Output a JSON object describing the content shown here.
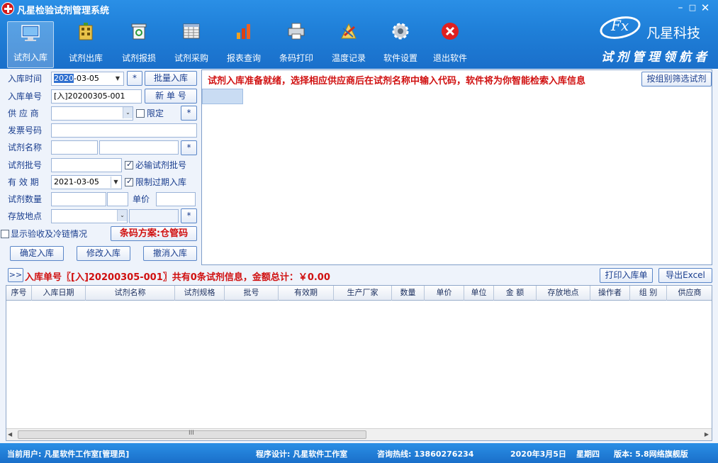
{
  "window": {
    "title": "凡星检验试剂管理系统",
    "min": "–",
    "max": "□",
    "close": "✕"
  },
  "brand": {
    "fx": "Fx",
    "name": "凡星科技",
    "slogan": "试剂管理领航者"
  },
  "toolbar": [
    {
      "label": "试剂入库",
      "icon": "monitor-icon"
    },
    {
      "label": "试剂出库",
      "icon": "building-icon"
    },
    {
      "label": "试剂报损",
      "icon": "recycle-bin-icon"
    },
    {
      "label": "试剂采购",
      "icon": "spreadsheet-icon"
    },
    {
      "label": "报表查询",
      "icon": "bar-chart-icon"
    },
    {
      "label": "条码打印",
      "icon": "printer-icon"
    },
    {
      "label": "温度记录",
      "icon": "thermometer-icon"
    },
    {
      "label": "软件设置",
      "icon": "gear-icon"
    },
    {
      "label": "退出软件",
      "icon": "exit-icon"
    }
  ],
  "form": {
    "date_label": "入库时间",
    "date_year": "2020",
    "date_rest": "-03-05",
    "star": "*",
    "batch_in": "批量入库",
    "order_label": "入库单号",
    "order_value": "[入]20200305-001",
    "new_order": "新 单 号",
    "supplier_label": "供 应 商",
    "supplier_value": "",
    "limit_label": "限定",
    "invoice_label": "发票号码",
    "invoice_value": "",
    "reagent_name_label": "试剂名称",
    "reagent_code": "",
    "reagent_name": "",
    "batch_label": "试剂批号",
    "batch_value": "",
    "must_batch": "必输试剂批号",
    "expiry_label": "有 效 期",
    "expiry_value": "2021-03-05",
    "limit_expired": "限制过期入库",
    "qty_label": "试剂数量",
    "qty_value": "",
    "price_label": "单价",
    "price_value": "",
    "location_label": "存放地点",
    "location_value": "",
    "show_cold": "显示验收及冷链情况",
    "barcode_plan": "条码方案:仓管码",
    "confirm_btn": "确定入库",
    "modify_btn": "修改入库",
    "cancel_btn": "撤消入库"
  },
  "right": {
    "message": "试剂入库准备就绪，选择相应供应商后在试剂名称中输入代码，软件将为你智能检索入库信息",
    "group_filter": "按组别筛选试剂"
  },
  "summary": {
    "expand": ">>",
    "text": "入库单号〖[入]20200305-001〗共有0条试剂信息，金额总计：￥0.00",
    "print": "打印入库单",
    "excel": "导出Excel"
  },
  "grid": {
    "columns": [
      "序号",
      "入库日期",
      "试剂名称",
      "试剂规格",
      "批号",
      "有效期",
      "生产厂家",
      "数量",
      "单价",
      "单位",
      "金 额",
      "存放地点",
      "操作者",
      "组 别",
      "供应商"
    ],
    "rows": [],
    "scroll_grip": "III"
  },
  "status": {
    "user": "当前用户: 凡星软件工作室[管理员]",
    "designer": "程序设计: 凡星软件工作室",
    "hotline": "咨询热线: 13860276234",
    "date": "2020年3月5日",
    "weekday": "星期四",
    "version": "版本: 5.8网络旗舰版"
  },
  "colors": {
    "accent": "#1f7fd8",
    "alert_text": "#d01010",
    "label_text": "#1a3e8e"
  }
}
